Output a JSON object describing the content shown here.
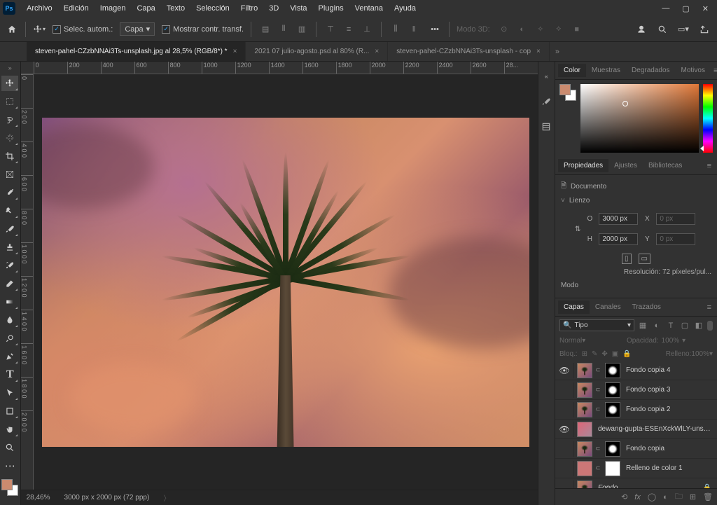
{
  "app": {
    "name": "Ps"
  },
  "menu": [
    "Archivo",
    "Edición",
    "Imagen",
    "Capa",
    "Texto",
    "Selección",
    "Filtro",
    "3D",
    "Vista",
    "Plugins",
    "Ventana",
    "Ayuda"
  ],
  "options": {
    "auto_select_label": "Selec. autom.:",
    "target": "Capa",
    "show_transform": "Mostrar contr. transf.",
    "mode3d": "Modo 3D:"
  },
  "tabs": [
    {
      "label": "steven-pahel-CZzbNNAi3Ts-unsplash.jpg al 28,5% (RGB/8*) *",
      "active": true
    },
    {
      "label": "2021 07 julio-agosto.psd al 80% (R...",
      "active": false
    },
    {
      "label": "steven-pahel-CZzbNNAi3Ts-unsplash - cop",
      "active": false
    }
  ],
  "rulerH": [
    "0",
    "200",
    "400",
    "600",
    "800",
    "1000",
    "1200",
    "1400",
    "1600",
    "1800",
    "2000",
    "2200",
    "2400",
    "2600",
    "28..."
  ],
  "rulerV": [
    "0",
    "2 0 0",
    "4 0 0",
    "6 0 0",
    "8 0 0",
    "1 0 0 0",
    "1 2 0 0",
    "1 4 0 0",
    "1 6 0 0",
    "1 8 0 0",
    "2 0 0 0"
  ],
  "status": {
    "zoom": "28,46%",
    "dims": "3000 px x 2000 px (72 ppp)"
  },
  "colorPanel": {
    "tabs": [
      "Color",
      "Muestras",
      "Degradados",
      "Motivos"
    ]
  },
  "propsPanel": {
    "tabs": [
      "Propiedades",
      "Ajustes",
      "Bibliotecas"
    ],
    "docLabel": "Documento",
    "section": "Lienzo",
    "w_lbl": "O",
    "w_val": "3000 px",
    "x_lbl": "X",
    "x_val": "0 px",
    "h_lbl": "H",
    "h_val": "2000 px",
    "y_lbl": "Y",
    "y_val": "0 px",
    "res": "Resolución:  72  píxeles/pul...",
    "mode": "Modo"
  },
  "layersPanel": {
    "tabs": [
      "Capas",
      "Canales",
      "Trazados"
    ],
    "kind": "Tipo",
    "blend": "Normal",
    "opacity_lbl": "Opacidad:",
    "opacity_val": "100%",
    "lock_lbl": "Bloq.:",
    "fill_lbl": "Relleno:",
    "fill_val": "100%",
    "layers": [
      {
        "vis": true,
        "mask": true,
        "name": "Fondo copia 4"
      },
      {
        "vis": false,
        "mask": true,
        "name": "Fondo copia 3"
      },
      {
        "vis": false,
        "mask": true,
        "name": "Fondo copia 2"
      },
      {
        "vis": true,
        "mask": false,
        "name": "dewang-gupta-ESEnXckWlLY-unsplash",
        "thumb": "pink"
      },
      {
        "vis": false,
        "mask": true,
        "name": "Fondo copia"
      },
      {
        "vis": false,
        "mask": false,
        "name": "Relleno de color 1",
        "thumb": "fill",
        "whitemask": true
      },
      {
        "vis": false,
        "mask": false,
        "name": "Fondo",
        "italic": true,
        "locked": true
      }
    ]
  }
}
